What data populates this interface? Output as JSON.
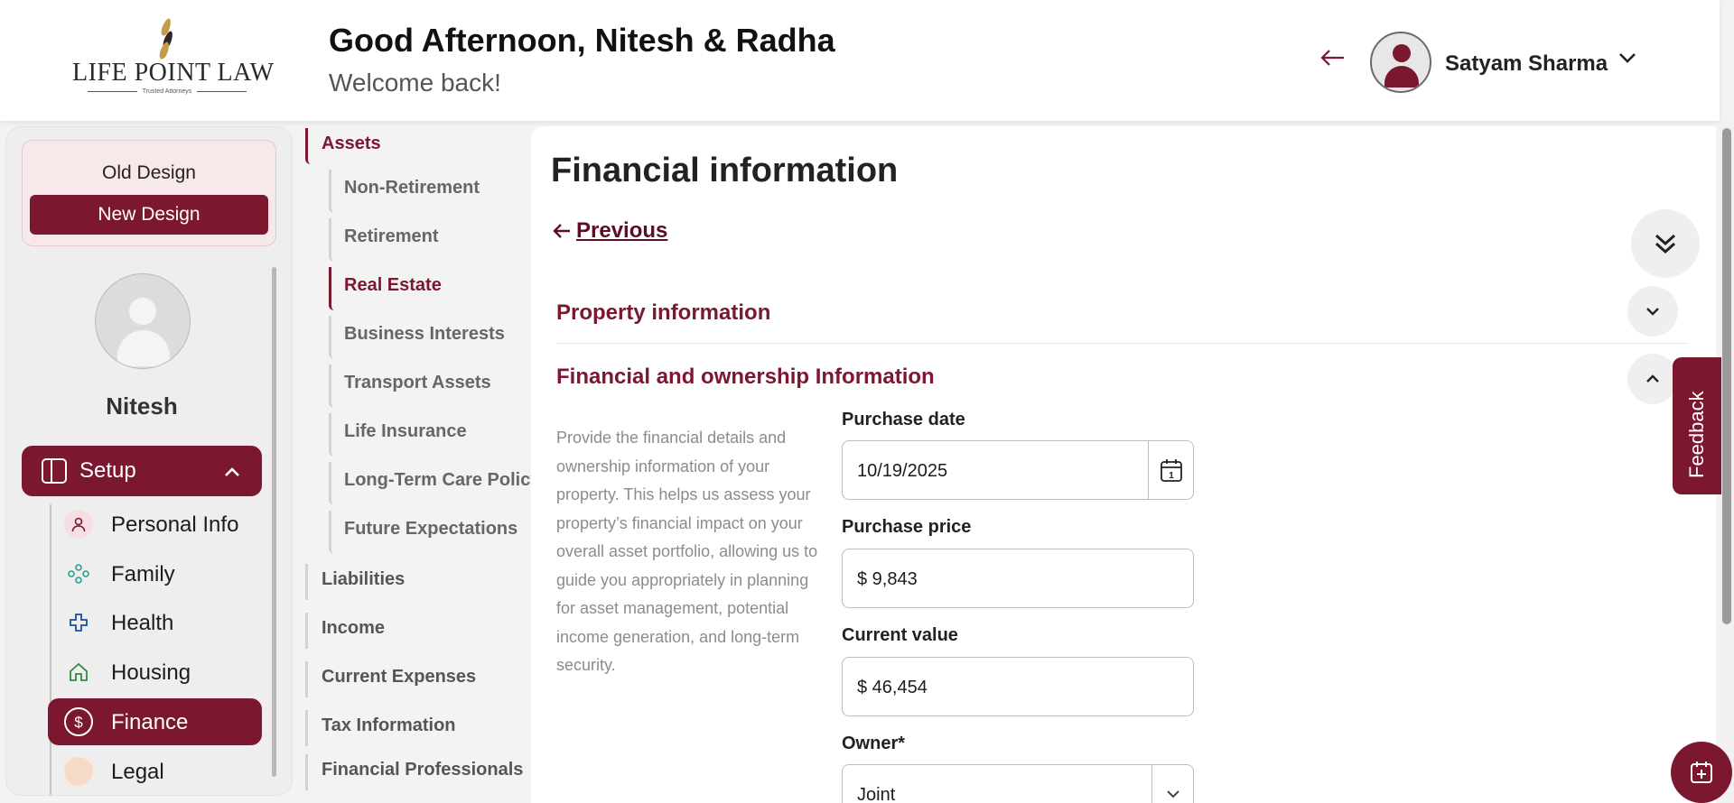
{
  "header": {
    "logo_text": "LIFE POINT LAW",
    "logo_tagline": "Trusted Attorneys",
    "greeting": "Good Afternoon, Nitesh & Radha",
    "welcome": "Welcome back!",
    "back_icon": "arrow-left-icon",
    "user_name": "Satyam Sharma"
  },
  "sidebar": {
    "old_design": "Old Design",
    "new_design": "New Design",
    "profile_name": "Nitesh",
    "setup_label": "Setup",
    "items": [
      {
        "label": "Personal Info",
        "icon": "person-icon",
        "active": false
      },
      {
        "label": "Family",
        "icon": "family-icon",
        "active": false
      },
      {
        "label": "Health",
        "icon": "health-cross-icon",
        "active": false
      },
      {
        "label": "Housing",
        "icon": "home-icon",
        "active": false
      },
      {
        "label": "Finance",
        "icon": "dollar-icon",
        "active": true
      },
      {
        "label": "Legal",
        "icon": "legal-icon",
        "active": false
      }
    ]
  },
  "subnav": {
    "assets": "Assets",
    "children": [
      "Non-Retirement",
      "Retirement",
      "Real Estate",
      "Business Interests",
      "Transport Assets",
      "Life Insurance",
      "Long-Term Care Policy",
      "Future Expectations"
    ],
    "active_child": "Real Estate",
    "others": [
      "Liabilities",
      "Income",
      "Current Expenses",
      "Tax Information",
      "Financial Professionals"
    ]
  },
  "main": {
    "title": "Financial information",
    "previous": "Previous",
    "section1": "Property information",
    "section2": "Financial and ownership Information",
    "description": "Provide the financial details and ownership information of your property. This helps us assess your property’s financial impact on your overall asset portfolio, allowing us to guide you appropriately in planning for asset management, potential income generation, and long-term security.",
    "purchase_date_label": "Purchase date",
    "purchase_date_value": "10/19/2025",
    "purchase_price_label": "Purchase price",
    "purchase_price_value": "$  9,843",
    "current_value_label": "Current value",
    "current_value_value": "$  46,454",
    "owner_label": "Owner*",
    "owner_value": "Joint"
  },
  "feedback": "Feedback",
  "colors": {
    "accent": "#7c1730",
    "accent_light": "#f7e8ea"
  }
}
